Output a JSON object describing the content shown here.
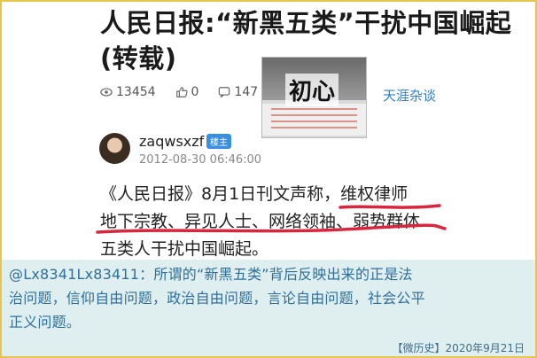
{
  "article": {
    "title_line1": "人民日报:“新黑五类”干扰中国崛起",
    "title_line2": "(转载)",
    "views": "13454",
    "likes": "0",
    "comments": "147",
    "source": "天涯杂谈",
    "thumbnail_caption": "初心",
    "username": "zaqwsxzf",
    "user_badge": "楼主",
    "timestamp": "2012-08-30 06:46:00",
    "body_line1": "《人民日报》8月1日刊文声称，维权律师",
    "body_line2": "地下宗教、异见人士、网络领袖、弱势群体",
    "body_line3": "五类人干扰中国崛起。",
    "underline_color": "#d7263d"
  },
  "comment": {
    "text_line1": "@Lx8341Lx83411：所谓的“新黑五类”背后反映出来的正是法",
    "text_line2": "治问题，信仰自由问题，政治自由问题，言论自由问题，社会公平",
    "text_line3": "正义问题。"
  },
  "footer": {
    "label": "【微历史】2020年9月21日"
  }
}
